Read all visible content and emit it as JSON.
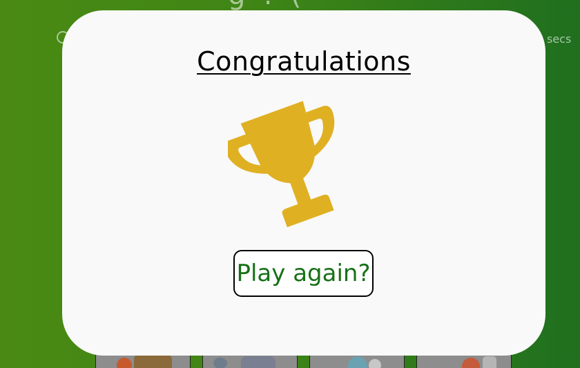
{
  "background": {
    "title_fragment": "g ! (",
    "timer_suffix": "secs",
    "card_count": 4
  },
  "modal": {
    "title": "Congratulations",
    "trophy_icon": "trophy-icon",
    "trophy_color": "#e0b023",
    "play_again_label": "Play again?",
    "play_again_color": "#177117"
  },
  "colors": {
    "background_green": "#3f8516",
    "modal_bg": "#f9f9f9"
  }
}
